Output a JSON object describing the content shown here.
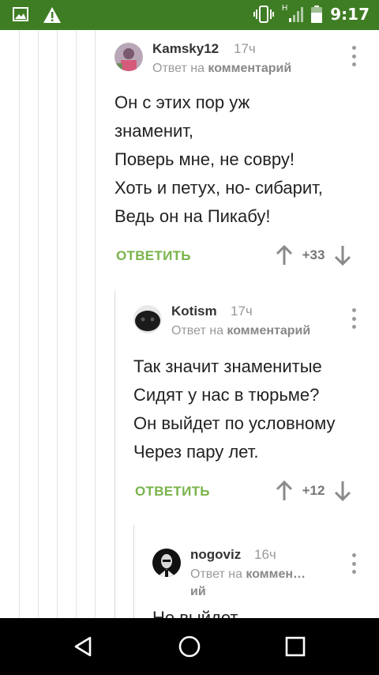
{
  "status_bar": {
    "time": "9:17",
    "network": "H",
    "icons": [
      "image-icon",
      "warning-icon",
      "vibrate-icon",
      "signal-icon",
      "battery-icon"
    ]
  },
  "reply_to_label": "Ответ на",
  "comments": [
    {
      "user": "Kamsky12",
      "time": "17ч",
      "reply_target": "комментарий",
      "text": "Он с этих пор уж\nзнаменит,\nПоверь мне, не совру!\nХоть и петух, но- сибарит,\nВедь он на Пикабу!",
      "reply_label": "ОТВЕТИТЬ",
      "rating": "+33"
    },
    {
      "user": "Kotism",
      "time": "17ч",
      "reply_target": "комментарий",
      "text": "Так значит знаменитые\nСидят у нас в тюрьме?\nОн выйдет по условному\nЧерез пару лет.",
      "reply_label": "ОТВЕТИТЬ",
      "rating": "+12"
    },
    {
      "user": "nogoviz",
      "time": "16ч",
      "reply_target_line1": "коммен…",
      "reply_target_line2": "ий",
      "text": "Не выйдет"
    }
  ],
  "colors": {
    "status_bar": "#3f7d24",
    "accent_green": "#79b34a",
    "nav_bar": "#000000"
  },
  "nav": [
    "back-icon",
    "home-icon",
    "recents-icon"
  ]
}
